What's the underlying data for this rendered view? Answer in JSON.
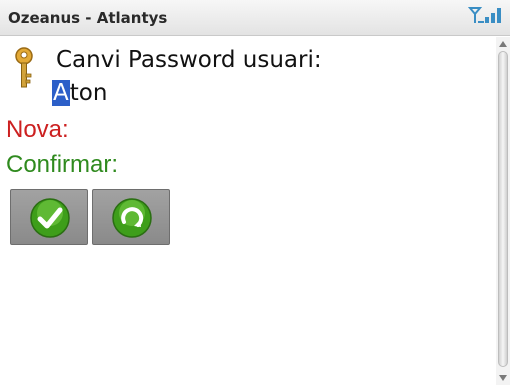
{
  "app": {
    "title": "Ozeanus - Atlantys"
  },
  "status": {
    "signal_icon": "signal-strength-icon"
  },
  "form": {
    "icon": "key-icon",
    "heading": "Canvi Password usuari:",
    "user_first_char": "A",
    "user_rest": "ton",
    "new_label": "Nova:",
    "confirm_label": "Confirmar:"
  },
  "buttons": {
    "confirm_icon": "checkmark-icon",
    "reset_icon": "refresh-icon"
  },
  "colors": {
    "new_label": "#cc2020",
    "confirm_label": "#2f8a1e",
    "selection": "#2c5fc8",
    "button_bg": "#9a9a9a",
    "button_icon": "#4fae22"
  }
}
